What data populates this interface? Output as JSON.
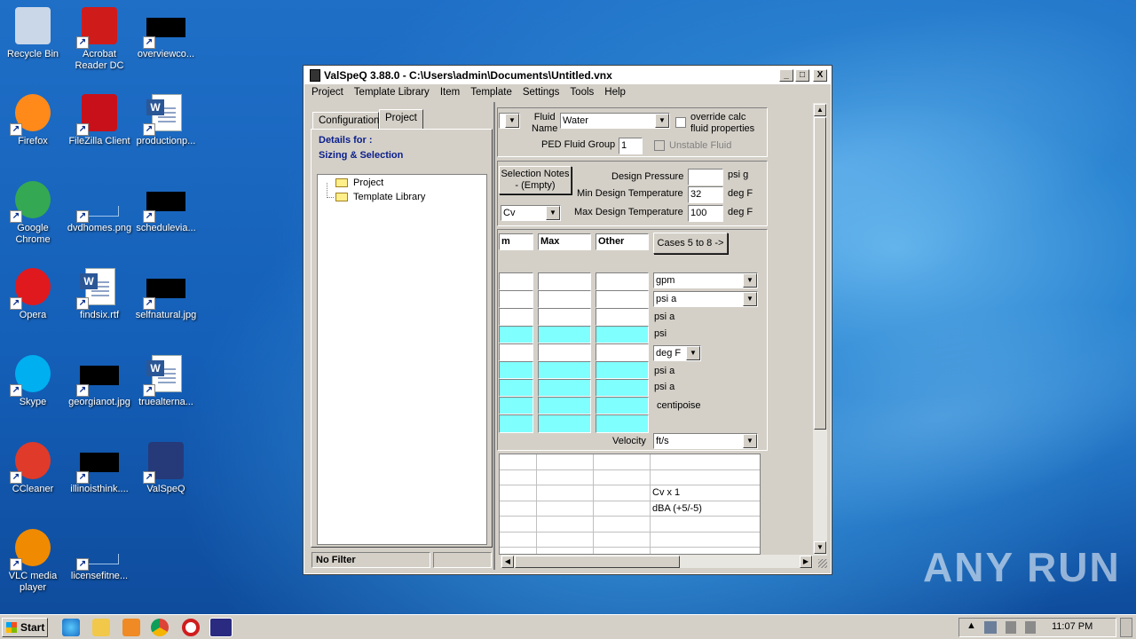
{
  "desktop": {
    "icons": [
      {
        "label": "Recycle Bin",
        "icon": "recycle-bin-icon"
      },
      {
        "label": "Acrobat Reader DC",
        "icon": "acrobat-icon"
      },
      {
        "label": "overviewco...",
        "icon": "image-file-icon"
      },
      {
        "label": "Firefox",
        "icon": "firefox-icon"
      },
      {
        "label": "FileZilla Client",
        "icon": "filezilla-icon"
      },
      {
        "label": "productionp...",
        "icon": "word-document-icon"
      },
      {
        "label": "Google Chrome",
        "icon": "chrome-icon"
      },
      {
        "label": "dvdhomes.png",
        "icon": "image-file-icon"
      },
      {
        "label": "schedulevia...",
        "icon": "image-file-icon"
      },
      {
        "label": "Opera",
        "icon": "opera-icon"
      },
      {
        "label": "findsix.rtf",
        "icon": "word-document-icon"
      },
      {
        "label": "selfnatural.jpg",
        "icon": "image-file-icon"
      },
      {
        "label": "Skype",
        "icon": "skype-icon"
      },
      {
        "label": "georgianot.jpg",
        "icon": "image-file-icon"
      },
      {
        "label": "truealterna...",
        "icon": "word-document-icon"
      },
      {
        "label": "CCleaner",
        "icon": "ccleaner-icon"
      },
      {
        "label": "illinoisthink....",
        "icon": "image-file-icon"
      },
      {
        "label": "ValSpeQ",
        "icon": "valspeq-icon"
      },
      {
        "label": "VLC media player",
        "icon": "vlc-icon"
      },
      {
        "label": "licensefitne...",
        "icon": "image-file-icon"
      }
    ]
  },
  "window": {
    "title": "ValSpeQ 3.88.0 - C:\\Users\\admin\\Documents\\Untitled.vnx",
    "min": "_",
    "max": "□",
    "close": "X"
  },
  "menu": [
    "Project",
    "Template Library",
    "Item",
    "Template",
    "Settings",
    "Tools",
    "Help"
  ],
  "leftpane": {
    "tabs": [
      "Configuration",
      "Project"
    ],
    "details_for": "Details for  :",
    "details_value": "Sizing & Selection",
    "tree": [
      "Project",
      "Template Library"
    ],
    "status": "No Filter"
  },
  "fluid": {
    "fluid_name_label": "Fluid\nName",
    "fluid_value": "Water",
    "override_label": "override calc fluid properties",
    "ped_label": "PED Fluid Group",
    "ped_value": "1",
    "unstable_label": "Unstable Fluid"
  },
  "design": {
    "selection_notes": "Selection Notes - (Empty)",
    "design_pressure_label": "Design Pressure",
    "design_pressure_value": "",
    "design_pressure_unit": "psi g",
    "min_temp_label": "Min Design Temperature",
    "min_temp_value": "32",
    "min_temp_unit": "deg F",
    "max_temp_label": "Max Design Temperature",
    "max_temp_value": "100",
    "max_temp_unit": "deg F",
    "cv_value": "Cv"
  },
  "cases": {
    "headers": [
      "m",
      "Max",
      "Other"
    ],
    "button": "Cases 5 to 8 ->",
    "units": [
      "gpm",
      "psi a",
      "psi a",
      "psi",
      "deg F",
      "psi a",
      "psi a",
      "centipoise"
    ],
    "velocity_label": "Velocity",
    "velocity_unit": "ft/s",
    "results_units": [
      "",
      "",
      "Cv x 1",
      "dBA (+5/-5)",
      "",
      ""
    ]
  },
  "taskbar": {
    "start": "Start",
    "time": "11:07 PM"
  },
  "watermark": "ANY RUN"
}
